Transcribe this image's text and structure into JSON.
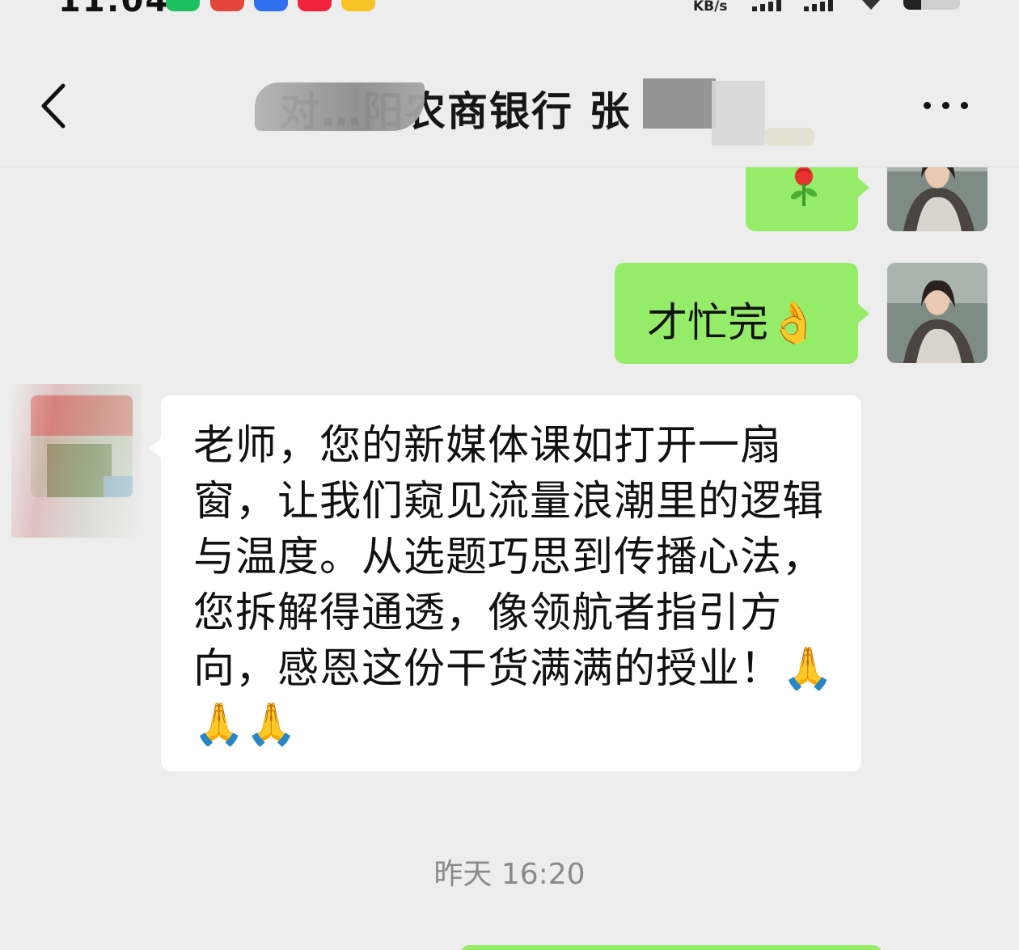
{
  "status_bar": {
    "time": "11:04",
    "network_speed": "KB/s",
    "app_icons": [
      "green-app-icon",
      "red-app-icon",
      "blue-app-icon",
      "red-square-app-icon",
      "weibo-icon"
    ]
  },
  "header": {
    "title": "对…阳农商银行 张",
    "back_icon": "chevron-left-icon",
    "more_icon": "more-icon"
  },
  "messages": [
    {
      "direction": "outgoing",
      "text": "🌹"
    },
    {
      "direction": "outgoing",
      "text": "才忙完👌"
    },
    {
      "direction": "incoming",
      "text": "老师，您的新媒体课如打开一扇窗，让我们窥见流量浪潮里的逻辑与温度。从选题巧思到传播心法，您拆解得通透，像领航者指引方向，感恩这份干货满满的授业！🙏🙏🙏"
    }
  ],
  "timestamp": "昨天 16:20",
  "colors": {
    "background": "#ededed",
    "outgoing_bubble": "#95ec69",
    "incoming_bubble": "#ffffff",
    "timestamp_text": "#8a8a8a"
  }
}
